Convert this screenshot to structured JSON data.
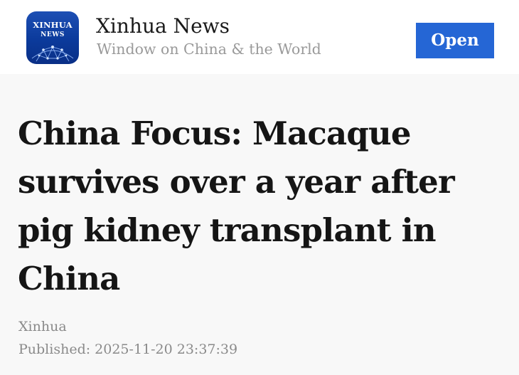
{
  "app_banner": {
    "logo": {
      "line1": "XINHUA",
      "line2": "NEWS",
      "colors": [
        "#1d4fb4",
        "#0a2f86"
      ]
    },
    "name": "Xinhua News",
    "tagline": "Window on China & the World",
    "open_label": "Open",
    "accent_color": "#2566d5"
  },
  "article": {
    "title": "China Focus: Macaque survives over a year after pig kidney transplant in China",
    "source": "Xinhua",
    "published": "Published: 2025-11-20 23:37:39"
  }
}
